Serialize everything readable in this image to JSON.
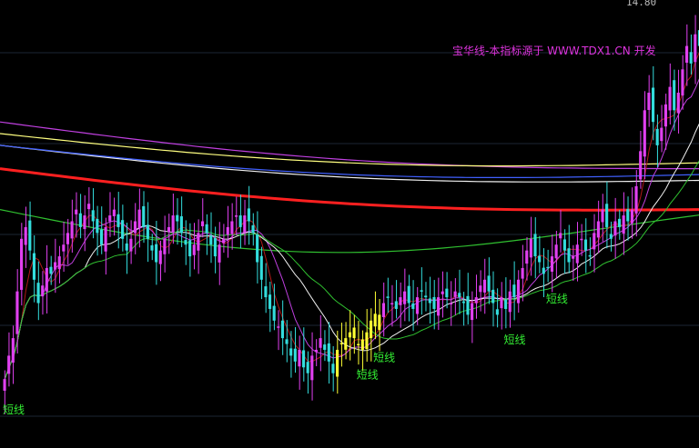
{
  "chart": {
    "price_label": "14.80",
    "watermark": "宝华线-本指标源于 WWW.TDX1.CN 开发",
    "colors": {
      "background": "#000000",
      "grid": "#1d2633",
      "candle_up": "#e040f0",
      "candle_down": "#33dddd",
      "candle_highlight": "#ffff33",
      "signal_text": "#33ee33",
      "ma_red": "#ff2020",
      "ma_white": "#f0f0f0",
      "ma_purple": "#c040e0",
      "ma_blue": "#4060ff",
      "ma_yellow": "#ffff80",
      "ma_green": "#30c030",
      "ma_darkred": "#b01818"
    }
  },
  "chart_data": {
    "type": "candlestick",
    "title": "",
    "watermark": "宝华线-本指标源于 WWW.TDX1.CN 开发",
    "top_price_label": "14.80",
    "annotations": [
      {
        "text": "短线",
        "index": 0
      },
      {
        "text": "短线",
        "index": 84
      },
      {
        "text": "短线",
        "index": 88
      },
      {
        "text": "短线",
        "index": 119
      },
      {
        "text": "短线",
        "index": 129
      }
    ],
    "candles_close": [
      8.9,
      9.3,
      9.6,
      10.4,
      11.3,
      11.5,
      11.1,
      10.6,
      10.2,
      10.5,
      10.8,
      10.7,
      10.9,
      11.0,
      11.2,
      11.4,
      11.6,
      11.8,
      11.5,
      11.7,
      11.9,
      11.6,
      11.4,
      11.2,
      11.5,
      11.7,
      11.8,
      11.5,
      11.3,
      11.1,
      11.3,
      11.6,
      11.8,
      11.5,
      11.3,
      11.1,
      10.9,
      11.1,
      11.3,
      11.5,
      11.7,
      11.6,
      11.4,
      11.2,
      11.0,
      11.2,
      11.4,
      11.6,
      11.4,
      11.2,
      11.0,
      11.2,
      11.3,
      11.5,
      11.6,
      11.7,
      11.5,
      11.7,
      11.6,
      11.4,
      10.9,
      10.6,
      10.3,
      10.1,
      9.9,
      9.8,
      9.6,
      9.5,
      9.3,
      9.2,
      9.4,
      9.1,
      9.0,
      9.3,
      9.4,
      9.6,
      9.4,
      9.2,
      9.0,
      9.4,
      9.5,
      9.6,
      9.7,
      9.6,
      9.5,
      9.4,
      9.7,
      9.9,
      9.8,
      10.0,
      10.2,
      10.3,
      10.2,
      10.1,
      10.3,
      10.4,
      10.2,
      10.1,
      10.3,
      10.4,
      10.3,
      10.2,
      10.1,
      10.3,
      10.4,
      10.3,
      10.2,
      10.4,
      10.3,
      10.2,
      10.0,
      10.2,
      10.3,
      10.5,
      10.6,
      10.4,
      10.2,
      10.0,
      10.3,
      10.1,
      10.4,
      10.3,
      10.6,
      10.8,
      11.1,
      11.3,
      11.0,
      10.9,
      10.7,
      10.8,
      11.0,
      11.2,
      11.4,
      11.1,
      10.9,
      11.0,
      11.2,
      11.3,
      11.1,
      11.0,
      11.4,
      11.6,
      11.8,
      11.5,
      11.3,
      11.6,
      11.5,
      11.7,
      11.6,
      11.8,
      12.2,
      12.8,
      13.5,
      13.8,
      13.3,
      12.9,
      13.2,
      13.6,
      13.9,
      13.5,
      13.8,
      14.2,
      14.6,
      14.3,
      14.8,
      14.6
    ],
    "moving_averages": [
      {
        "color": "red",
        "trend": "declining",
        "start": 12.5,
        "end": 11.8
      },
      {
        "color": "white",
        "trend": "declining",
        "start": 12.9,
        "end": 12.3
      },
      {
        "color": "purple",
        "trend": "declining",
        "start": 13.3,
        "end": 12.5
      },
      {
        "color": "blue",
        "trend": "declining",
        "start": 12.9,
        "end": 12.4
      },
      {
        "color": "yellow",
        "trend": "declining",
        "start": 13.1,
        "end": 12.6
      },
      {
        "color": "green",
        "trend": "declining",
        "start": 11.8,
        "end": 11.5
      }
    ]
  }
}
